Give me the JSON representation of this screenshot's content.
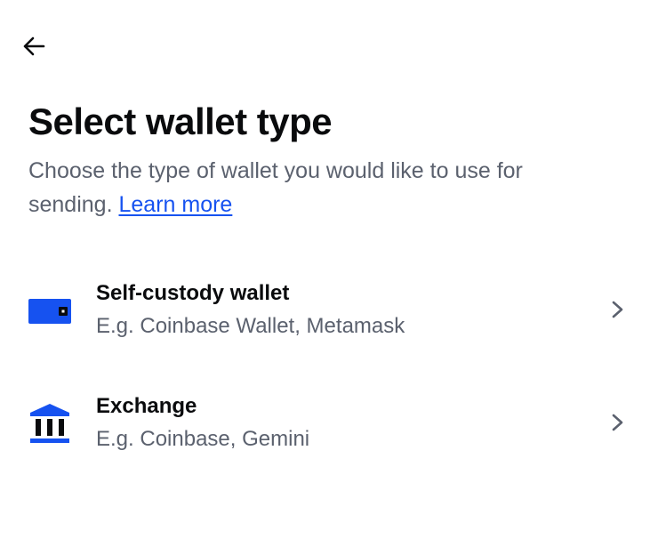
{
  "header": {
    "back_icon": "arrow-left-icon",
    "title": "Select wallet type",
    "subtitle": "Choose the type of wallet you would like to use for sending.",
    "learn_more": "Learn more"
  },
  "options": [
    {
      "icon": "wallet-icon",
      "title": "Self-custody wallet",
      "description": "E.g. Coinbase Wallet, Metamask"
    },
    {
      "icon": "bank-icon",
      "title": "Exchange",
      "description": "E.g. Coinbase, Gemini"
    }
  ],
  "colors": {
    "accent": "#1652f0",
    "text_primary": "#0a0b0d",
    "text_secondary": "#5b616e"
  }
}
